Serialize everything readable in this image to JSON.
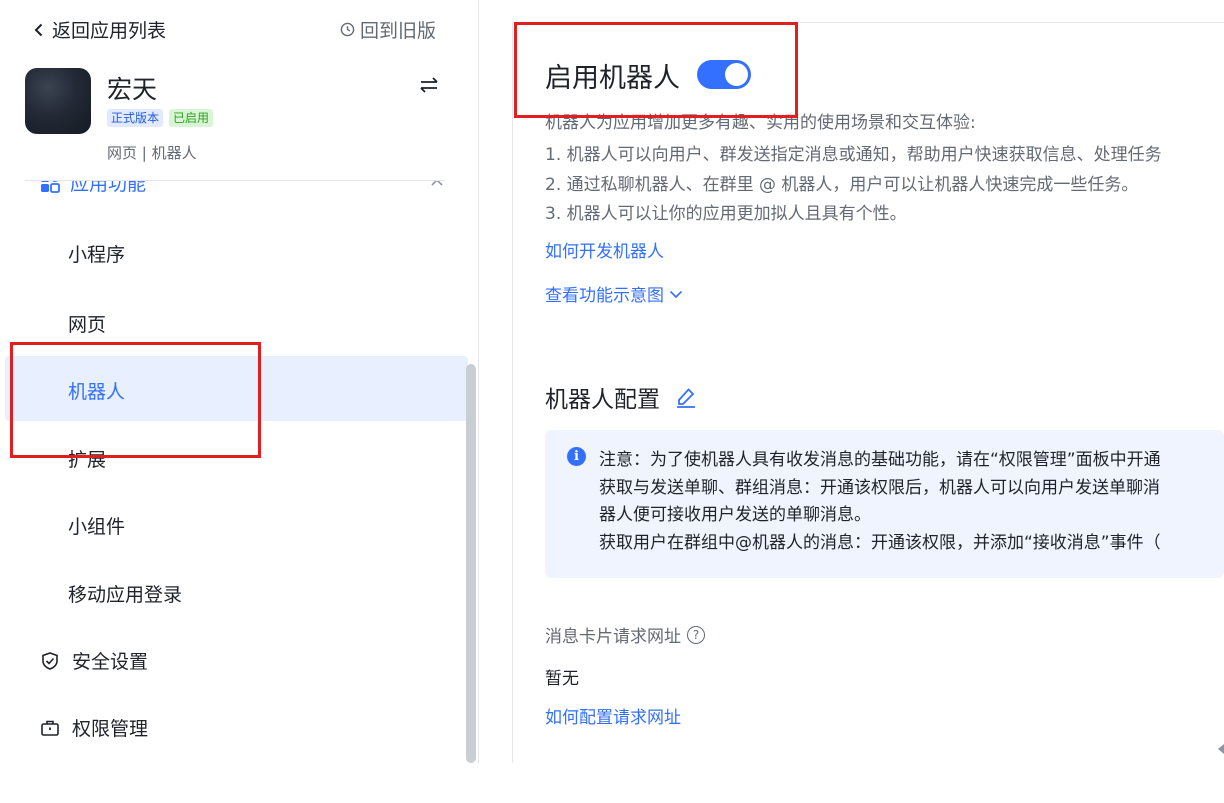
{
  "sidebar": {
    "back_label": "返回应用列表",
    "old_version_label": "回到旧版",
    "app": {
      "name": "宏天",
      "badge_version": "正式版本",
      "badge_status": "已启用",
      "meta": "网页 | 机器人"
    },
    "section_label": "应用功能",
    "items": [
      {
        "label": "小程序"
      },
      {
        "label": "网页"
      },
      {
        "label": "机器人"
      },
      {
        "label": "扩展"
      },
      {
        "label": "小组件"
      },
      {
        "label": "移动应用登录"
      }
    ],
    "main_items": [
      {
        "label": "安全设置",
        "icon": "shield-check-icon"
      },
      {
        "label": "权限管理",
        "icon": "briefcase-icon"
      }
    ]
  },
  "main": {
    "title": "启用机器人",
    "toggle_on": true,
    "description": [
      "机器人为应用增加更多有趣、实用的使用场景和交互体验:",
      "1. 机器人可以向用户、群发送指定消息或通知，帮助用户快速获取信息、处理任务",
      "2. 通过私聊机器人、在群里 @ 机器人，用户可以让机器人快速完成一些任务。",
      "3. 机器人可以让你的应用更加拟人且具有个性。"
    ],
    "link_develop": "如何开发机器人",
    "link_diagram": "查看功能示意图",
    "config_title": "机器人配置",
    "notice": [
      "注意：为了使机器人具有收发消息的基础功能，请在“权限管理”面板中开通",
      "获取与发送单聊、群组消息：开通该权限后，机器人可以向用户发送单聊消",
      "器人便可接收用户发送的单聊消息。",
      "获取用户在群组中@机器人的消息：开通该权限，并添加“接收消息”事件（"
    ],
    "field_label": "消息卡片请求网址",
    "field_value": "暂无",
    "link_config": "如何配置请求网址"
  },
  "colors": {
    "accent": "#3370ff",
    "highlight": "#e02020",
    "active_bg": "#e8efff",
    "notice_bg": "#f0f4ff"
  }
}
